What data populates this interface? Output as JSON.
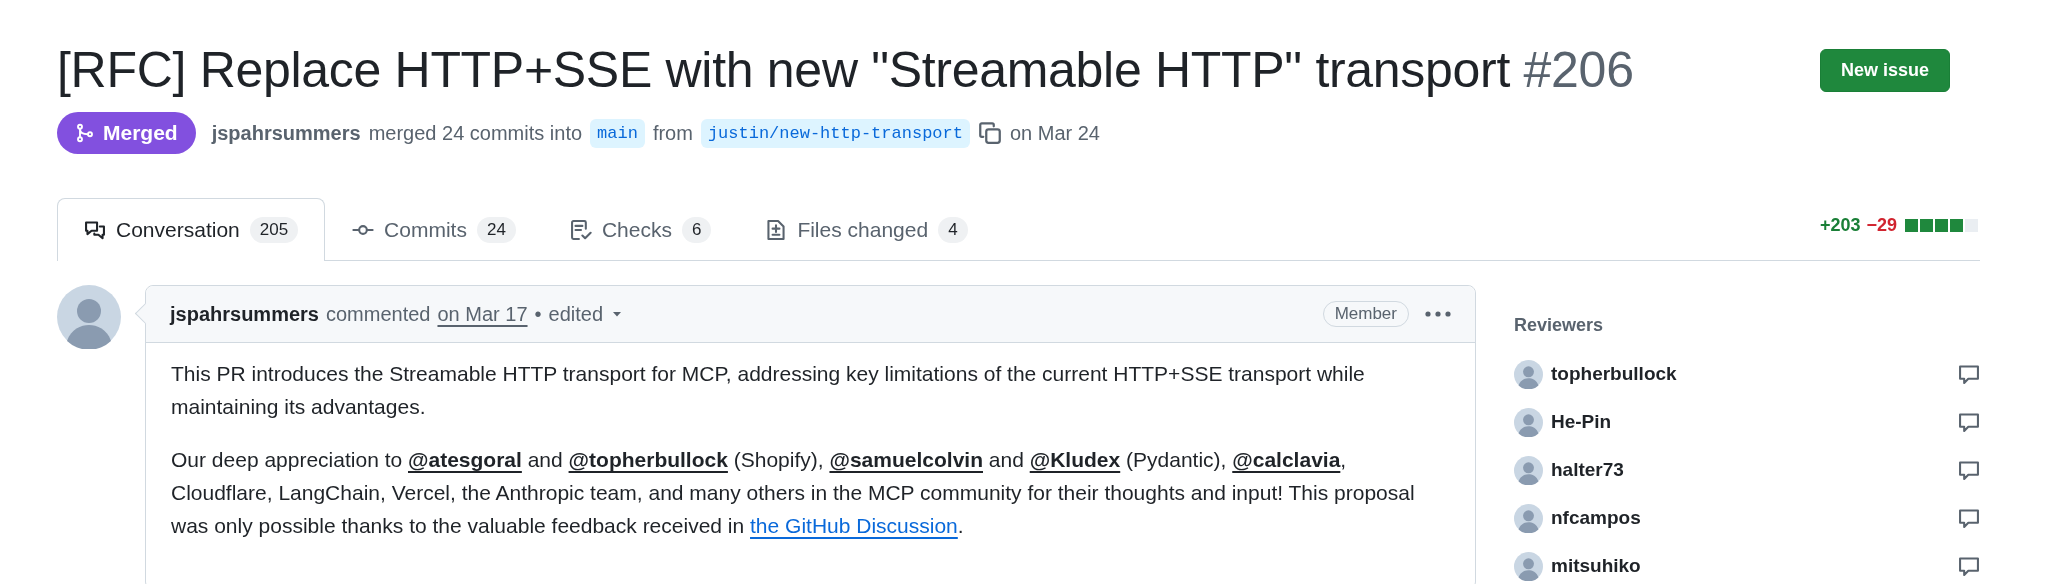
{
  "title": {
    "text": "[RFC] Replace HTTP+SSE with new \"Streamable HTTP\" transport",
    "number": "#206"
  },
  "new_issue_button": "New issue",
  "state_badge": {
    "label": "Merged",
    "kind": "merged"
  },
  "merge_summary": {
    "author": "jspahrsummers",
    "text": "merged 24 commits into",
    "base_branch": "main",
    "from": "from",
    "head_branch": "justin/new-http-transport",
    "date": "on Mar 24"
  },
  "tabs": [
    {
      "label": "Conversation",
      "count": "205",
      "selected": true
    },
    {
      "label": "Commits",
      "count": "24",
      "selected": false
    },
    {
      "label": "Checks",
      "count": "6",
      "selected": false
    },
    {
      "label": "Files changed",
      "count": "4",
      "selected": false
    }
  ],
  "diffstat": {
    "additions": "+203",
    "deletions": "−29",
    "level": 0.8
  },
  "comment": {
    "author": "jspahrsummers",
    "action": "commented",
    "date": "on Mar 17",
    "separator": "•",
    "edited": "edited",
    "role": "Member",
    "paragraphs": [
      [
        {
          "kind": "text",
          "text": "This PR introduces the Streamable HTTP transport for MCP, addressing key limitations of the current HTTP+SSE transport while maintaining its advantages."
        }
      ],
      [
        {
          "kind": "text",
          "text": "Our deep appreciation to "
        },
        {
          "kind": "mention",
          "text": "@atesgoral"
        },
        {
          "kind": "text",
          "text": " and "
        },
        {
          "kind": "mention",
          "text": "@topherbullock"
        },
        {
          "kind": "text",
          "text": " (Shopify), "
        },
        {
          "kind": "mention",
          "text": "@samuelcolvin"
        },
        {
          "kind": "text",
          "text": " and "
        },
        {
          "kind": "mention",
          "text": "@Kludex"
        },
        {
          "kind": "text",
          "text": " (Pydantic), "
        },
        {
          "kind": "mention",
          "text": "@calclavia"
        },
        {
          "kind": "text",
          "text": ", Cloudflare, LangChain, Vercel, the Anthropic team, and many others in the MCP community for their thoughts and input! This proposal was only possible thanks to the valuable feedback received in "
        },
        {
          "kind": "link",
          "text": "the GitHub Discussion"
        },
        {
          "kind": "text",
          "text": "."
        }
      ]
    ]
  },
  "sidebar": {
    "reviewers": {
      "heading": "Reviewers",
      "items": [
        {
          "name": "topherbullock"
        },
        {
          "name": "He-Pin"
        },
        {
          "name": "halter73"
        },
        {
          "name": "nfcampos"
        },
        {
          "name": "mitsuhiko"
        }
      ]
    }
  }
}
